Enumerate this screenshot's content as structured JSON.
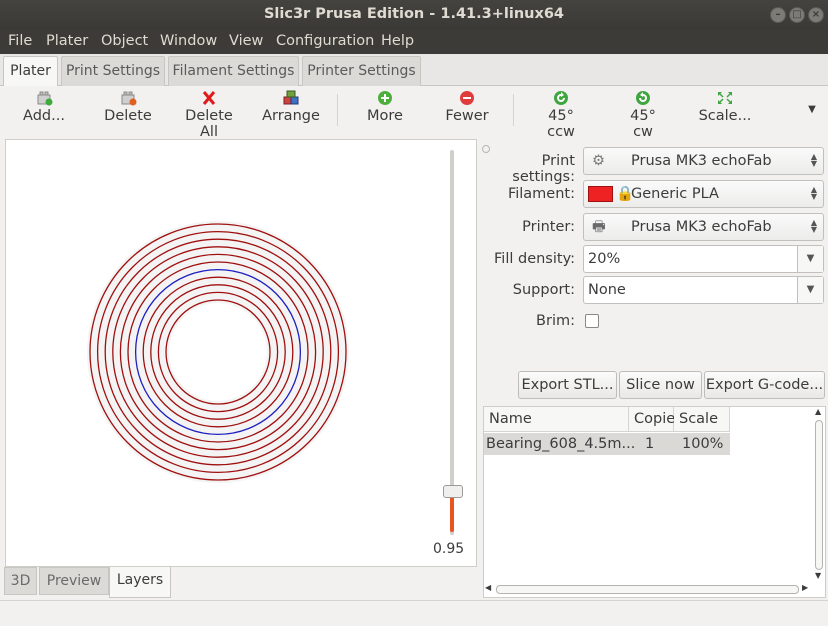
{
  "window": {
    "title": "Slic3r Prusa Edition - 1.41.3+linux64"
  },
  "menu": [
    "File",
    "Plater",
    "Object",
    "Window",
    "View",
    "Configuration",
    "Help"
  ],
  "tabs": [
    "Plater",
    "Print Settings",
    "Filament Settings",
    "Printer Settings"
  ],
  "toolbar": {
    "add": "Add...",
    "delete": "Delete",
    "delete_all": "Delete All",
    "arrange": "Arrange",
    "more": "More",
    "fewer": "Fewer",
    "rotate_ccw": "45° ccw",
    "rotate_cw": "45° cw",
    "scale": "Scale..."
  },
  "layer_slider": {
    "value": "0.95"
  },
  "view_tabs": [
    "3D",
    "Preview",
    "Layers"
  ],
  "settings": {
    "print_label": "Print settings:",
    "print_value": "Prusa MK3 echoFab",
    "filament_label": "Filament:",
    "filament_value": "Generic PLA",
    "filament_color": "#ee2222",
    "printer_label": "Printer:",
    "printer_value": "Prusa MK3 echoFab",
    "fill_label": "Fill density:",
    "fill_value": "20%",
    "support_label": "Support:",
    "support_value": "None",
    "brim_label": "Brim:",
    "brim_checked": false
  },
  "actions": {
    "export_stl": "Export STL...",
    "slice_now": "Slice now",
    "export_gcode": "Export G-code..."
  },
  "object_list": {
    "columns": [
      "Name",
      "Copie",
      "Scale"
    ],
    "rows": [
      {
        "name": "Bearing_608_4.5m...",
        "copies": "1",
        "scale": "100%"
      }
    ]
  },
  "colors": {
    "accent": "#e95420",
    "layer_red": "#a01010",
    "layer_blue": "#2020c0"
  }
}
